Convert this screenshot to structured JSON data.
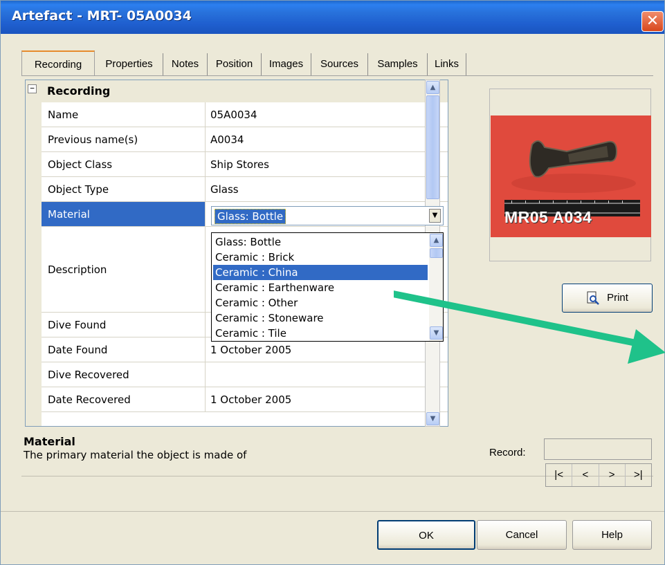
{
  "window": {
    "title": "Artefact - MRT- 05A0034",
    "close_glyph": "✕"
  },
  "tabs": [
    {
      "label": "Recording"
    },
    {
      "label": "Properties"
    },
    {
      "label": "Notes"
    },
    {
      "label": "Position"
    },
    {
      "label": "Images"
    },
    {
      "label": "Sources"
    },
    {
      "label": "Samples"
    },
    {
      "label": "Links"
    }
  ],
  "active_tab": "Recording",
  "grid": {
    "category": "Recording",
    "expander_glyph": "−",
    "rows": [
      {
        "name": "Name",
        "value": "05A0034"
      },
      {
        "name": "Previous name(s)",
        "value": "A0034"
      },
      {
        "name": "Object Class",
        "value": "Ship Stores"
      },
      {
        "name": "Object Type",
        "value": "Glass"
      },
      {
        "name": "Material",
        "value": "Glass: Bottle"
      },
      {
        "name": "Description",
        "value": ""
      },
      {
        "name": "Dive Found",
        "value": ""
      },
      {
        "name": "Date Found",
        "value": "1 October 2005"
      },
      {
        "name": "Dive Recovered",
        "value": ""
      },
      {
        "name": "Date Recovered",
        "value": "1 October 2005"
      }
    ],
    "selected_row": "Material"
  },
  "material_dropdown": {
    "selected": "Glass: Bottle",
    "options": [
      "Glass: Bottle",
      "Ceramic : Brick",
      "Ceramic : China",
      "Ceramic : Earthenware",
      "Ceramic : Other",
      "Ceramic : Stoneware",
      "Ceramic : Tile"
    ],
    "highlighted": "Ceramic : China"
  },
  "image": {
    "photo_label": "MR05 A034"
  },
  "buttons": {
    "print": "Print",
    "ok": "OK",
    "cancel": "Cancel",
    "help": "Help"
  },
  "help_panel": {
    "title": "Material",
    "description": "The primary material the object is made of"
  },
  "record_nav": {
    "label": "Record:",
    "value": "",
    "first": "|<",
    "prev": "<",
    "next": ">",
    "last": ">|"
  },
  "colors": {
    "titlebar": "#2872db",
    "selection": "#316ac5",
    "arrow": "#1fc28a",
    "photo_bg": "#e04a3d"
  },
  "icons": [
    "close-icon",
    "print-preview-icon",
    "scroll-up-icon",
    "scroll-down-icon",
    "dropdown-arrow-icon",
    "annotation-arrow"
  ]
}
